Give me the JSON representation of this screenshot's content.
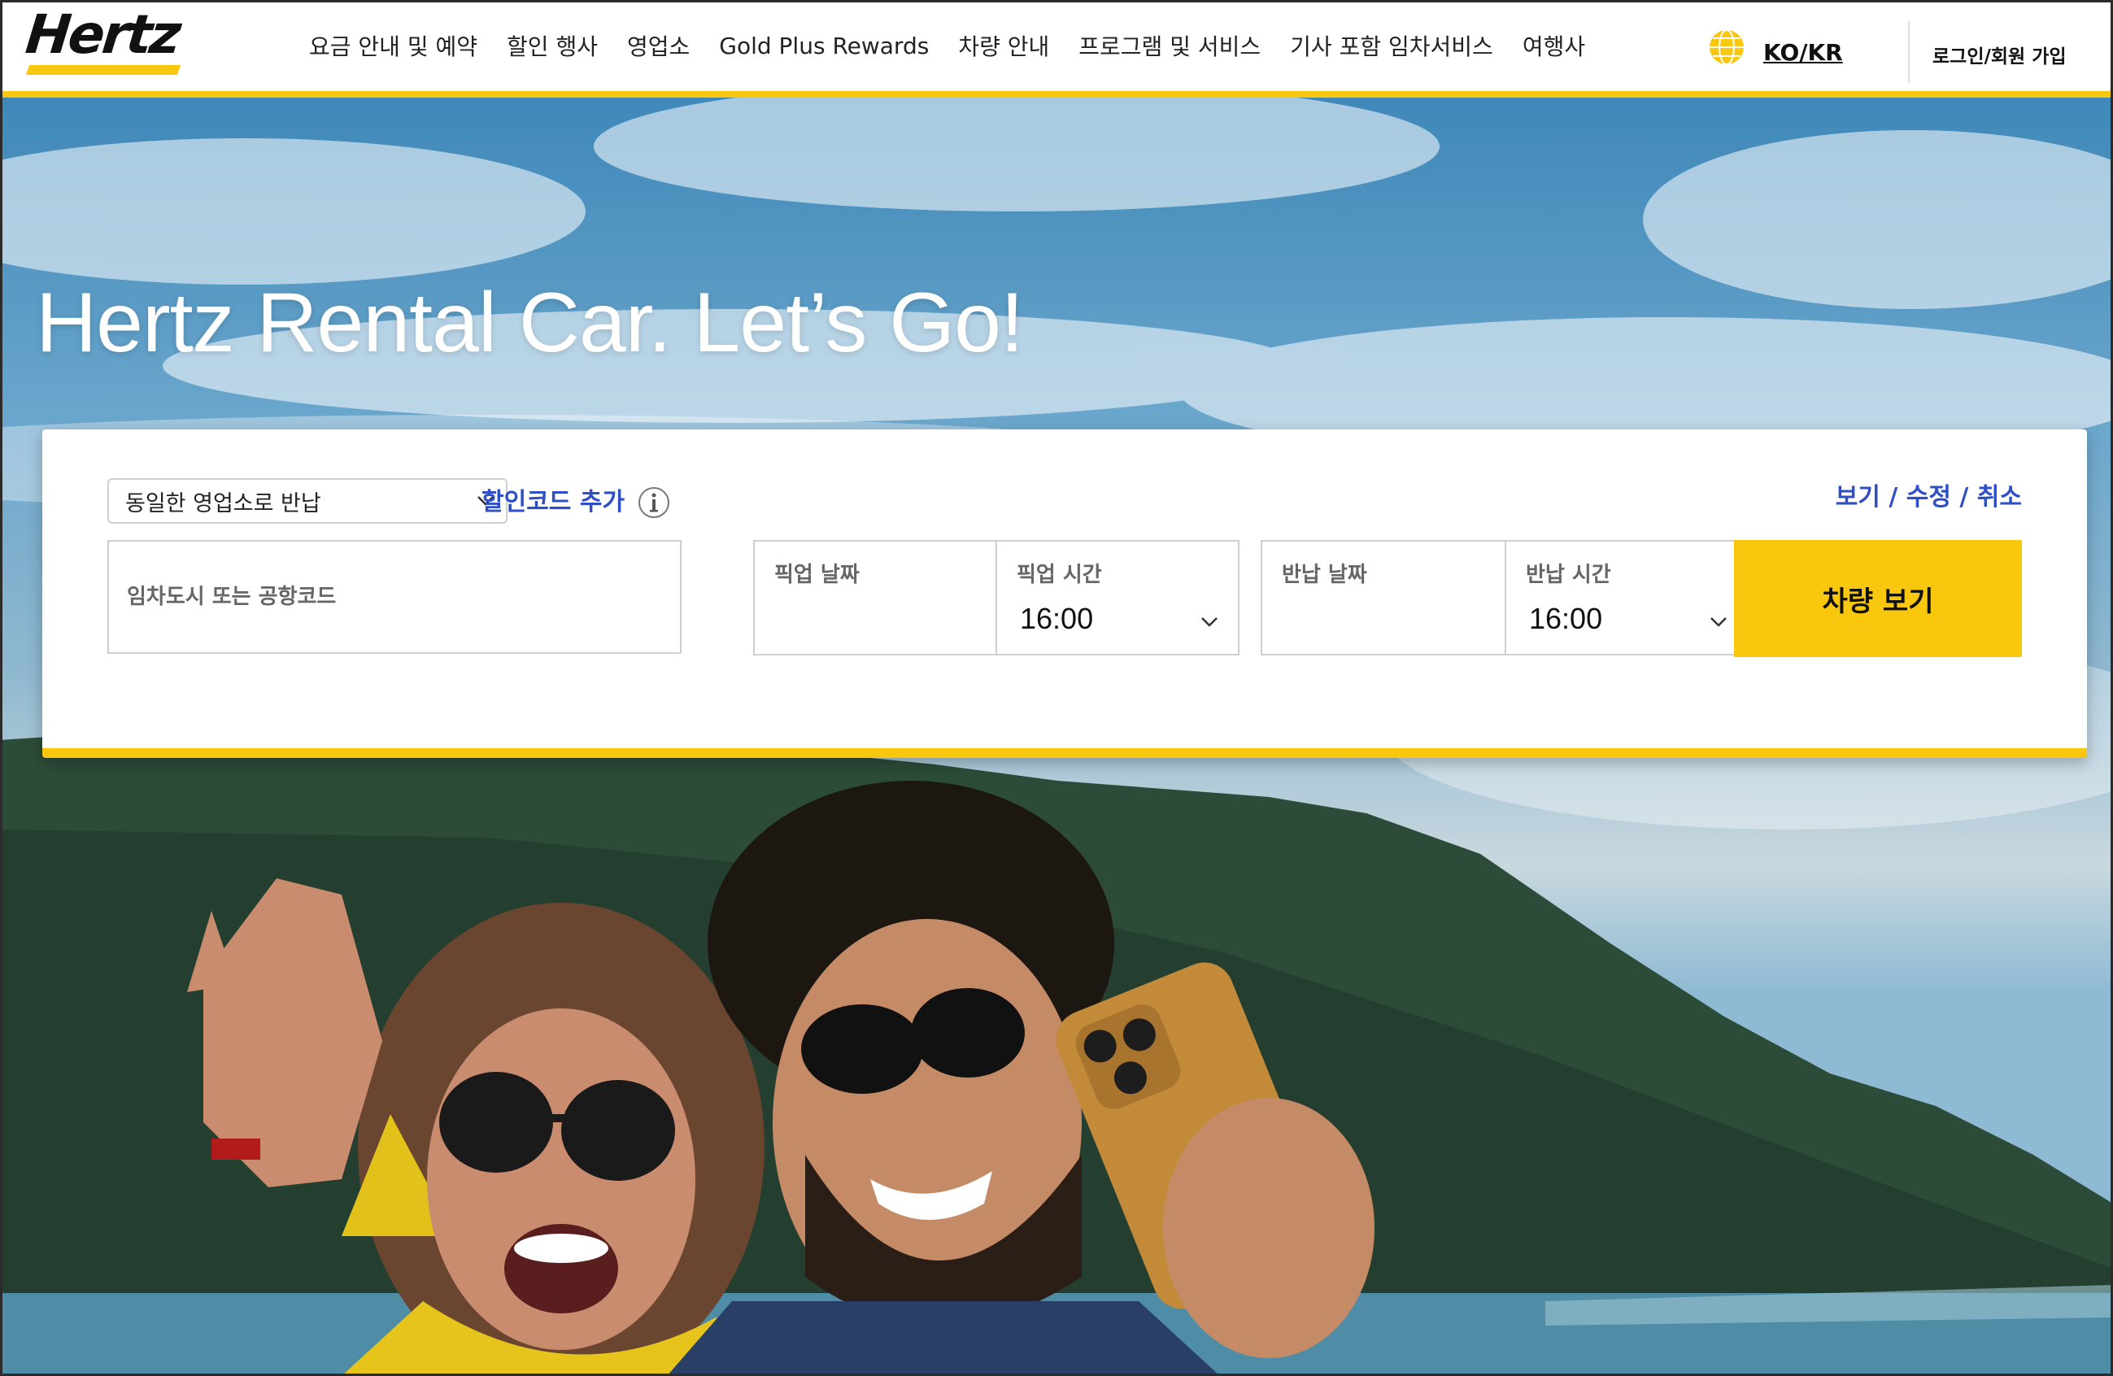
{
  "header": {
    "logo_text": "Hertz",
    "nav": [
      "요금 안내 및 예약",
      "할인 행사",
      "영업소",
      "Gold Plus Rewards",
      "차량 안내",
      "프로그램 및 서비스",
      "기사 포함 임차서비스",
      "여행사"
    ],
    "language": "KO/KR",
    "login": "로그인/회원 가입"
  },
  "hero": {
    "title": "Hertz Rental Car. Let’s Go!"
  },
  "booking": {
    "return_option": "동일한 영업소로 반납",
    "discount_link": "할인코드 추가",
    "manage_link": "보기 / 수정 / 취소",
    "location_placeholder": "임차도시 또는 공항코드",
    "pickup_date_label": "픽업 날짜",
    "pickup_time_label": "픽업 시간",
    "pickup_time_value": "16:00",
    "return_date_label": "반납 날짜",
    "return_time_label": "반납 시간",
    "return_time_value": "16:00",
    "search_button": "차량 보기"
  },
  "colors": {
    "brand_yellow": "#f9c80e",
    "link_blue": "#2f4fc7",
    "text_dark": "#111111"
  },
  "icons": {
    "globe": "globe-icon",
    "info": "info-icon",
    "dropdown": "chevron-down-icon"
  }
}
